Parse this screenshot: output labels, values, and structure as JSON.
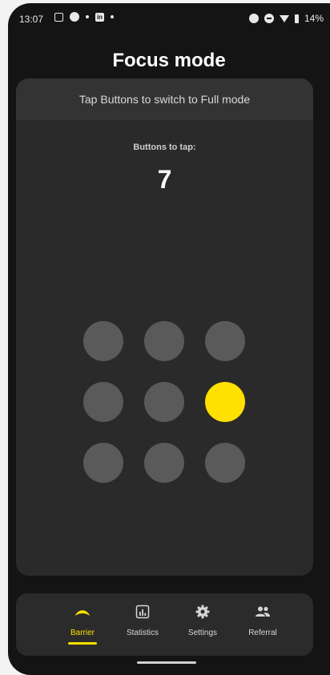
{
  "status_bar": {
    "time": "13:07",
    "battery": "14%"
  },
  "header": {
    "title": "Focus mode"
  },
  "card": {
    "instruction": "Tap Buttons to switch to Full mode",
    "buttons_label": "Buttons to tap:",
    "buttons_count": "7"
  },
  "grid": {
    "rows": 3,
    "cols": 3,
    "active_index": 5,
    "active_color": "#ffe000",
    "inactive_color": "#5a5a5a"
  },
  "nav": {
    "items": [
      {
        "label": "Barrier",
        "icon": "barrier-icon",
        "active": true
      },
      {
        "label": "Statistics",
        "icon": "statistics-icon",
        "active": false
      },
      {
        "label": "Settings",
        "icon": "settings-icon",
        "active": false
      },
      {
        "label": "Referral",
        "icon": "referral-icon",
        "active": false
      }
    ]
  }
}
